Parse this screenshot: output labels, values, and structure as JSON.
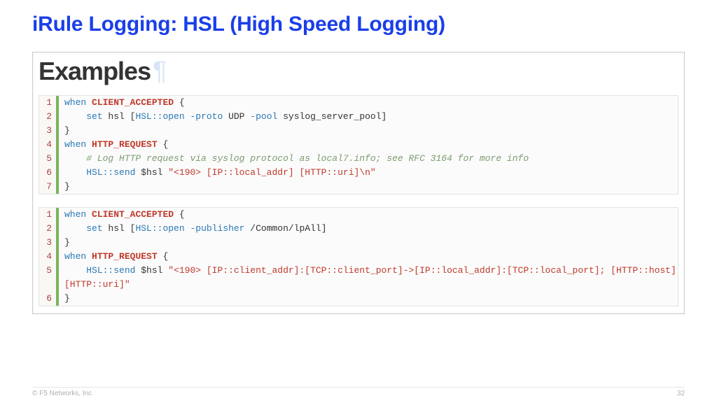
{
  "title": "iRule Logging: HSL (High Speed Logging)",
  "examples_heading": "Examples",
  "code1": {
    "lines": [
      {
        "n": "1",
        "tokens": [
          {
            "t": "kw",
            "v": "when"
          },
          {
            "t": "plain",
            "v": " "
          },
          {
            "t": "ev",
            "v": "CLIENT_ACCEPTED"
          },
          {
            "t": "plain",
            "v": " {"
          }
        ]
      },
      {
        "n": "2",
        "tokens": [
          {
            "t": "plain",
            "v": "    "
          },
          {
            "t": "kw",
            "v": "set"
          },
          {
            "t": "plain",
            "v": " hsl ["
          },
          {
            "t": "fn",
            "v": "HSL::open"
          },
          {
            "t": "plain",
            "v": " "
          },
          {
            "t": "kw",
            "v": "-proto"
          },
          {
            "t": "plain",
            "v": " UDP "
          },
          {
            "t": "kw",
            "v": "-pool"
          },
          {
            "t": "plain",
            "v": " syslog_server_pool]"
          }
        ]
      },
      {
        "n": "3",
        "tokens": [
          {
            "t": "plain",
            "v": "}"
          }
        ]
      },
      {
        "n": "4",
        "tokens": [
          {
            "t": "kw",
            "v": "when"
          },
          {
            "t": "plain",
            "v": " "
          },
          {
            "t": "ev",
            "v": "HTTP_REQUEST"
          },
          {
            "t": "plain",
            "v": " {"
          }
        ]
      },
      {
        "n": "5",
        "tokens": [
          {
            "t": "plain",
            "v": "    "
          },
          {
            "t": "cmt",
            "v": "# Log HTTP request via syslog protocol as local7.info; see RFC 3164 for more info"
          }
        ]
      },
      {
        "n": "6",
        "tokens": [
          {
            "t": "plain",
            "v": "    "
          },
          {
            "t": "fn",
            "v": "HSL::send"
          },
          {
            "t": "plain",
            "v": " $hsl "
          },
          {
            "t": "str",
            "v": "\"<190> [IP::local_addr] [HTTP::uri]\\n\""
          }
        ]
      },
      {
        "n": "7",
        "tokens": [
          {
            "t": "plain",
            "v": "}"
          }
        ]
      }
    ]
  },
  "code2": {
    "lines": [
      {
        "n": "1",
        "tokens": [
          {
            "t": "kw",
            "v": "when"
          },
          {
            "t": "plain",
            "v": " "
          },
          {
            "t": "ev",
            "v": "CLIENT_ACCEPTED"
          },
          {
            "t": "plain",
            "v": " {"
          }
        ]
      },
      {
        "n": "2",
        "tokens": [
          {
            "t": "plain",
            "v": "    "
          },
          {
            "t": "kw",
            "v": "set"
          },
          {
            "t": "plain",
            "v": " hsl ["
          },
          {
            "t": "fn",
            "v": "HSL::open"
          },
          {
            "t": "plain",
            "v": " "
          },
          {
            "t": "kw",
            "v": "-publisher"
          },
          {
            "t": "plain",
            "v": " /Common/lpAll]"
          }
        ]
      },
      {
        "n": "3",
        "tokens": [
          {
            "t": "plain",
            "v": "}"
          }
        ]
      },
      {
        "n": "4",
        "tokens": [
          {
            "t": "kw",
            "v": "when"
          },
          {
            "t": "plain",
            "v": " "
          },
          {
            "t": "ev",
            "v": "HTTP_REQUEST"
          },
          {
            "t": "plain",
            "v": " {"
          }
        ]
      },
      {
        "n": "5",
        "tokens": [
          {
            "t": "plain",
            "v": "    "
          },
          {
            "t": "fn",
            "v": "HSL::send"
          },
          {
            "t": "plain",
            "v": " $hsl "
          },
          {
            "t": "str",
            "v": "\"<190> [IP::client_addr]:[TCP::client_port]->[IP::local_addr]:[TCP::local_port]; [HTTP::host][HTTP::uri]\""
          }
        ]
      },
      {
        "n": "6",
        "tokens": [
          {
            "t": "plain",
            "v": "}"
          }
        ]
      }
    ]
  },
  "footer": {
    "copyright": "© F5 Networks, Inc",
    "page": "32"
  }
}
